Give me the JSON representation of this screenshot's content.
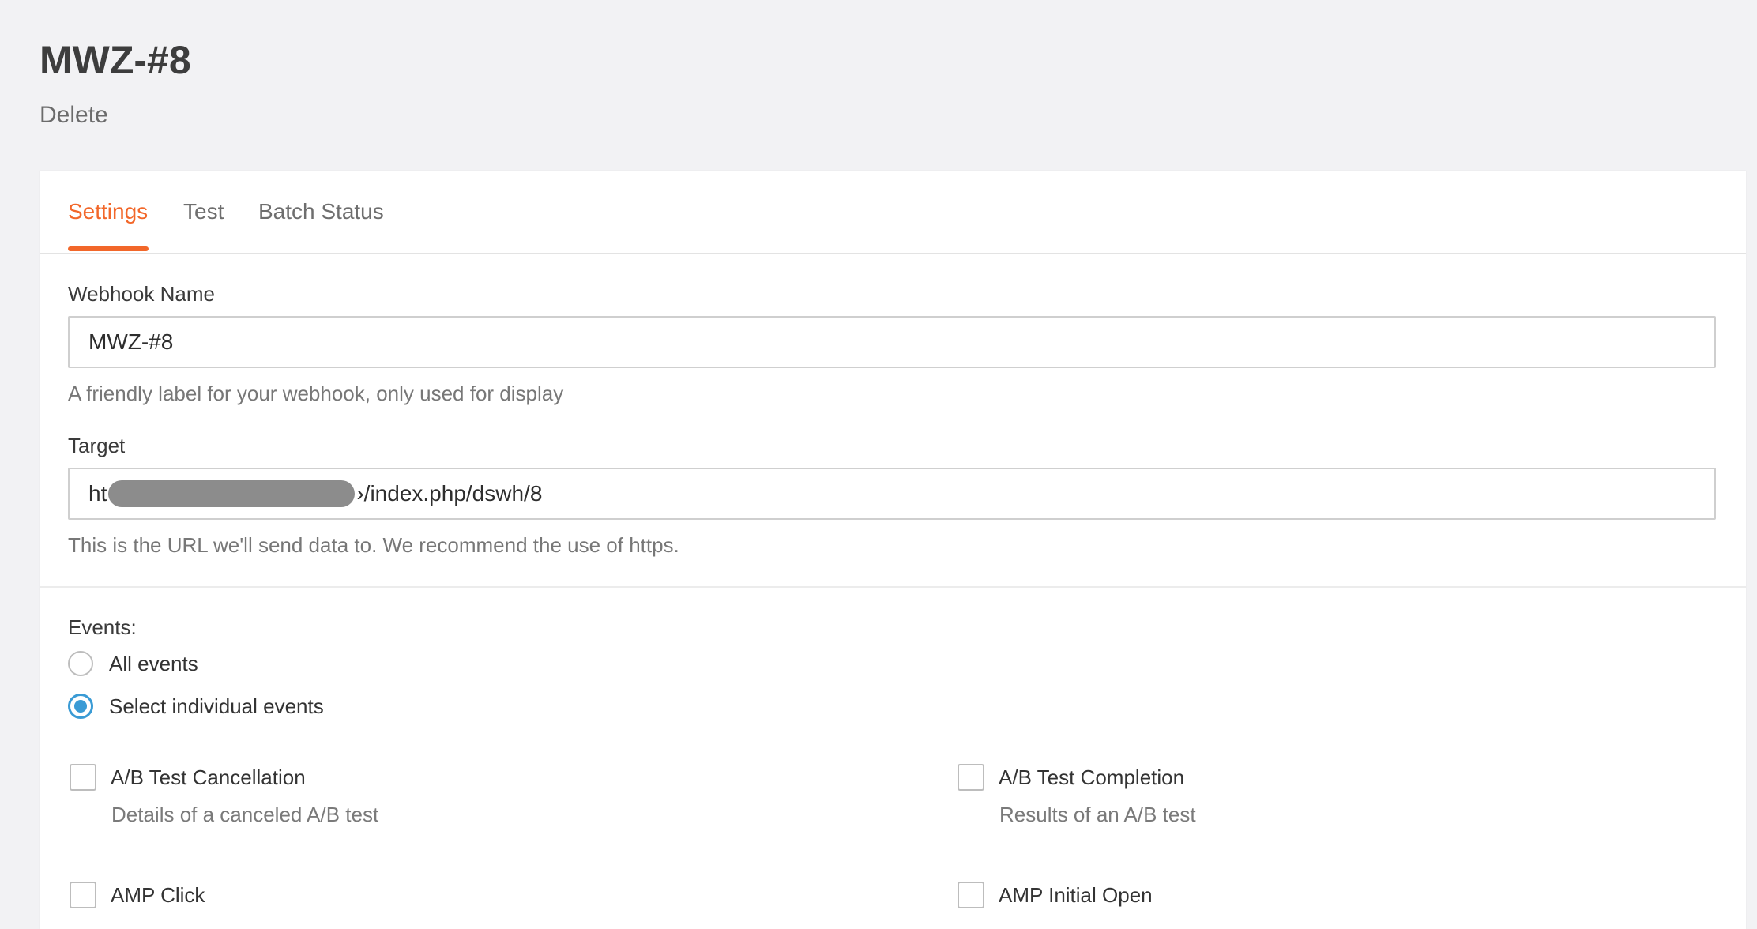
{
  "header": {
    "title": "MWZ-#8",
    "delete_label": "Delete"
  },
  "tabs": [
    {
      "label": "Settings",
      "active": true
    },
    {
      "label": "Test",
      "active": false
    },
    {
      "label": "Batch Status",
      "active": false
    }
  ],
  "form": {
    "webhook_name": {
      "label": "Webhook Name",
      "value": "MWZ-#8",
      "help": "A friendly label for your webhook, only used for display"
    },
    "target": {
      "label": "Target",
      "value_prefix": "ht",
      "value_suffix": "›/index.php/dswh/8",
      "help": "This is the URL we'll send data to. We recommend the use of https."
    }
  },
  "events": {
    "label": "Events:",
    "options": [
      {
        "label": "All events",
        "checked": false
      },
      {
        "label": "Select individual events",
        "checked": true
      }
    ],
    "items": [
      {
        "label": "A/B Test Cancellation",
        "description": "Details of a canceled A/B test"
      },
      {
        "label": "A/B Test Completion",
        "description": "Results of an A/B test"
      },
      {
        "label": "AMP Click",
        "description": ""
      },
      {
        "label": "AMP Initial Open",
        "description": ""
      }
    ]
  },
  "colors": {
    "accent": "#f2672a",
    "radio_selected": "#3a9bd5",
    "background": "#f2f2f4"
  }
}
